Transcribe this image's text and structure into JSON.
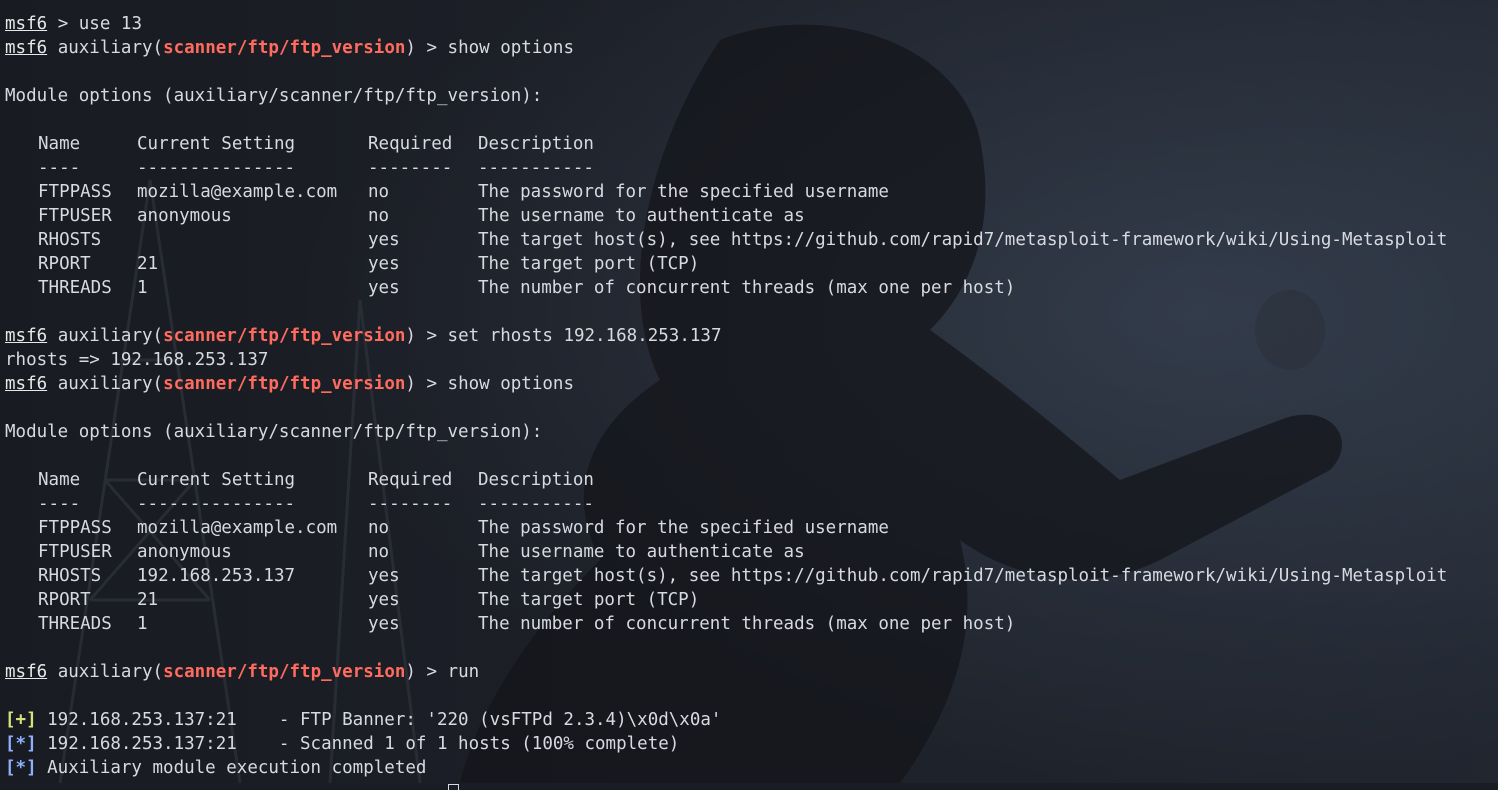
{
  "background": {
    "base_color": "#1a1d24",
    "description_hidden": true
  },
  "prompt": {
    "msf": "msf6",
    "aux_prefix": " auxiliary(",
    "aux_module": "scanner/ftp/ftp_version",
    "aux_suffix": ") > "
  },
  "lines": {
    "l1_prefix": " > use 13",
    "cmd_show_options": "show options",
    "cmd_set_rhosts": "set rhosts 192.168.253.137",
    "rhosts_echo": "rhosts => 192.168.253.137",
    "cmd_run": "run",
    "module_options_header": "Module options (auxiliary/scanner/ftp/ftp_version):"
  },
  "table": {
    "headers": [
      "Name",
      "Current Setting",
      "Required",
      "Description"
    ],
    "underlines": [
      "----",
      "---------------",
      "--------",
      "-----------"
    ],
    "rows_first": [
      [
        "FTPPASS",
        "mozilla@example.com",
        "no",
        "The password for the specified username"
      ],
      [
        "FTPUSER",
        "anonymous",
        "no",
        "The username to authenticate as"
      ],
      [
        "RHOSTS",
        "",
        "yes",
        "The target host(s), see https://github.com/rapid7/metasploit-framework/wiki/Using-Metasploit"
      ],
      [
        "RPORT",
        "21",
        "yes",
        "The target port (TCP)"
      ],
      [
        "THREADS",
        "1",
        "yes",
        "The number of concurrent threads (max one per host)"
      ]
    ],
    "rows_second": [
      [
        "FTPPASS",
        "mozilla@example.com",
        "no",
        "The password for the specified username"
      ],
      [
        "FTPUSER",
        "anonymous",
        "no",
        "The username to authenticate as"
      ],
      [
        "RHOSTS",
        "192.168.253.137",
        "yes",
        "The target host(s), see https://github.com/rapid7/metasploit-framework/wiki/Using-Metasploit"
      ],
      [
        "RPORT",
        "21",
        "yes",
        "The target port (TCP)"
      ],
      [
        "THREADS",
        "1",
        "yes",
        "The number of concurrent threads (max one per host)"
      ]
    ]
  },
  "results": {
    "good_marker": "[+]",
    "info_marker": "[*]",
    "banner_line": " 192.168.253.137:21    - FTP Banner: '220 (vsFTPd 2.3.4)\\x0d\\x0a'",
    "scanned_line": " 192.168.253.137:21    - Scanned 1 of 1 hosts (100% complete)",
    "completed_line": " Auxiliary module execution completed"
  },
  "colors": {
    "text": "#d7dae0",
    "module": "#ff6b5e",
    "good": "#d9e27a",
    "info": "#8fb0ff"
  }
}
